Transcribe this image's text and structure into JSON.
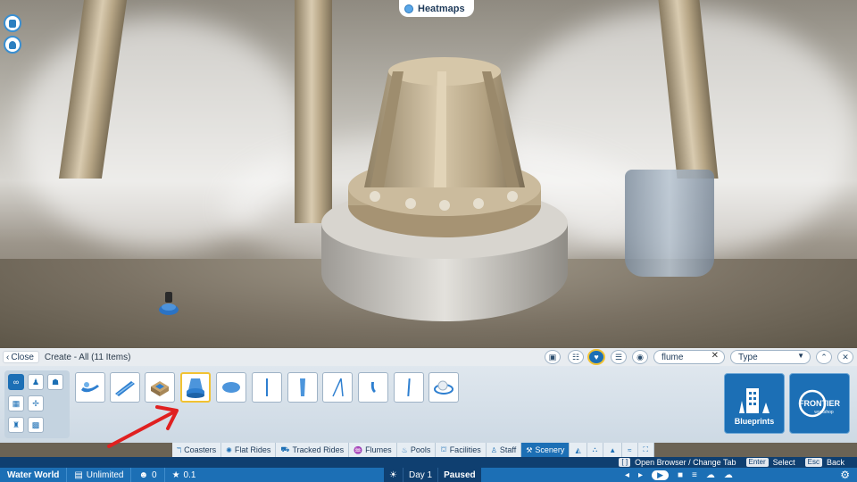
{
  "heatmaps": {
    "label": "Heatmaps"
  },
  "panel": {
    "close_label": "Close",
    "title": "Create - All (11 Items)",
    "search_value": "flume",
    "type_select_value": "Type"
  },
  "filters": [
    "∞",
    "♟",
    "☗",
    "▦",
    "✢",
    "♜",
    "▩"
  ],
  "items_count": 11,
  "blueprints_label": "Blueprints",
  "frontier_label": "FRONTIER",
  "frontier_sub": "workshop",
  "tabs": [
    {
      "label": "Coasters",
      "icon": "ℸ"
    },
    {
      "label": "Flat Rides",
      "icon": "✺"
    },
    {
      "label": "Tracked Rides",
      "icon": "⛟"
    },
    {
      "label": "Flumes",
      "icon": "♒"
    },
    {
      "label": "Pools",
      "icon": "♨"
    },
    {
      "label": "Facilities",
      "icon": "⛫"
    },
    {
      "label": "Staff",
      "icon": "♙"
    },
    {
      "label": "Scenery",
      "icon": "⚒"
    }
  ],
  "hints": {
    "browser_key": "[ ]",
    "browser_label": "Open Browser / Change Tab",
    "enter_key": "Enter",
    "enter_label": "Select",
    "esc_key": "Esc",
    "esc_label": "Back"
  },
  "status": {
    "park_name": "Water World",
    "money": "Unlimited",
    "guests": "0",
    "rating": "0.1",
    "day": "Day 1",
    "state": "Paused"
  },
  "colors": {
    "accent": "#1c6fb5",
    "selected_border": "#f1c232",
    "hint_bar": "#0f3f70",
    "arrow": "#e02020"
  }
}
